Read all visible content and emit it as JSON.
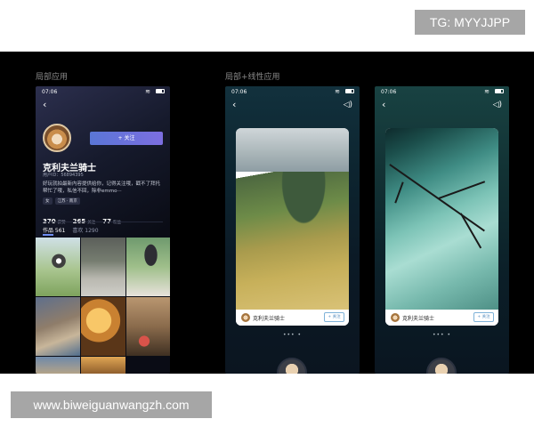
{
  "watermarks": {
    "top": "TG: MYYJJPP",
    "bottom": "www.biweiguanwangzh.com"
  },
  "sections": {
    "local": "局部应用",
    "local_linear": "局部+线性应用"
  },
  "status_bar": {
    "time": "07:06",
    "wifi": "wifi-icon",
    "battery": "battery-icon"
  },
  "profile": {
    "follow_button": "+ 关注",
    "name": "克利夫兰骑士",
    "uid": "用户ID：56894395",
    "bio": "好玩就拍最新内容提供给你，记得关注哦，戳不了拜托帮忙了哦，私信不回，除非emmo···",
    "tags": [
      "女",
      "江苏 · 南京"
    ],
    "stats": [
      {
        "value": "370",
        "label": "获赞"
      },
      {
        "value": "265",
        "label": "关注"
      },
      {
        "value": "77",
        "label": "粉丝"
      }
    ],
    "tabs": [
      {
        "label": "作品 561"
      },
      {
        "label": "喜欢 1290"
      }
    ]
  },
  "cards": [
    {
      "name": "克利夫兰骑士",
      "follow": "+ 关注"
    },
    {
      "name": "克利夫兰骑士",
      "follow": "+ 关注"
    }
  ],
  "pager": "••• •",
  "icons": {
    "back": "chevron-left-icon",
    "volume": "speaker-icon"
  },
  "colors": {
    "accent": "#6d7ee6",
    "background": "#000000"
  }
}
